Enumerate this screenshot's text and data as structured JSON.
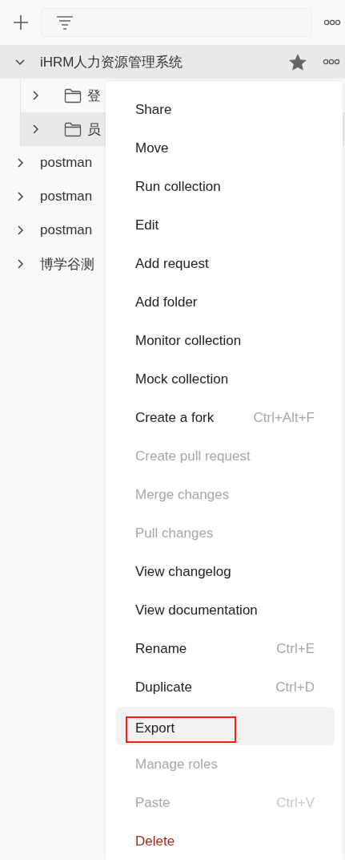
{
  "tree": [
    {
      "label": "iHRM人力资源管理系统",
      "expanded": true,
      "highlighted": true,
      "starred": true,
      "children": [
        {
          "label": "登",
          "kind": "folder",
          "expanded": false,
          "highlighted": false
        },
        {
          "label": "员",
          "kind": "folder",
          "expanded": false,
          "highlighted": true
        }
      ]
    },
    {
      "label": "postman",
      "expanded": false,
      "highlighted": false,
      "starred": false
    },
    {
      "label": "postman",
      "expanded": false,
      "highlighted": false,
      "starred": false
    },
    {
      "label": "postman",
      "expanded": false,
      "highlighted": false,
      "starred": false
    },
    {
      "label": "博学谷测",
      "expanded": false,
      "highlighted": false,
      "starred": false
    }
  ],
  "menu": [
    {
      "label": "Share",
      "kind": "normal",
      "disabled": false,
      "selected": false,
      "annotated": false
    },
    {
      "label": "Move",
      "kind": "normal",
      "disabled": false,
      "selected": false,
      "annotated": false
    },
    {
      "label": "Run collection",
      "kind": "normal",
      "disabled": false,
      "selected": false,
      "annotated": false
    },
    {
      "label": "Edit",
      "kind": "normal",
      "disabled": false,
      "selected": false,
      "annotated": false
    },
    {
      "label": "Add request",
      "kind": "normal",
      "disabled": false,
      "selected": false,
      "annotated": false
    },
    {
      "label": "Add folder",
      "kind": "normal",
      "disabled": false,
      "selected": false,
      "annotated": false
    },
    {
      "label": "Monitor collection",
      "kind": "normal",
      "disabled": false,
      "selected": false,
      "annotated": false
    },
    {
      "label": "Mock collection",
      "kind": "normal",
      "disabled": false,
      "selected": false,
      "annotated": false
    },
    {
      "label": "Create a fork",
      "shortcut": "Ctrl+Alt+F",
      "kind": "normal",
      "disabled": false,
      "selected": false,
      "annotated": false
    },
    {
      "label": "Create pull request",
      "kind": "normal",
      "disabled": true,
      "selected": false,
      "annotated": false
    },
    {
      "label": "Merge changes",
      "kind": "normal",
      "disabled": true,
      "selected": false,
      "annotated": false
    },
    {
      "label": "Pull changes",
      "kind": "normal",
      "disabled": true,
      "selected": false,
      "annotated": false
    },
    {
      "label": "View changelog",
      "kind": "normal",
      "disabled": false,
      "selected": false,
      "annotated": false
    },
    {
      "label": "View documentation",
      "kind": "normal",
      "disabled": false,
      "selected": false,
      "annotated": false
    },
    {
      "label": "Rename",
      "shortcut": "Ctrl+E",
      "kind": "normal",
      "disabled": false,
      "selected": false,
      "annotated": false
    },
    {
      "label": "Duplicate",
      "shortcut": "Ctrl+D",
      "kind": "normal",
      "disabled": false,
      "selected": false,
      "annotated": false
    },
    {
      "label": "Export",
      "kind": "normal",
      "disabled": false,
      "selected": true,
      "annotated": true
    },
    {
      "label": "Manage roles",
      "kind": "normal",
      "disabled": true,
      "selected": false,
      "annotated": false
    },
    {
      "label": "Paste",
      "shortcut": "Ctrl+V",
      "kind": "normal",
      "disabled": true,
      "selected": false,
      "annotated": false
    },
    {
      "label": "Delete",
      "kind": "danger",
      "disabled": false,
      "selected": false,
      "annotated": false
    }
  ]
}
